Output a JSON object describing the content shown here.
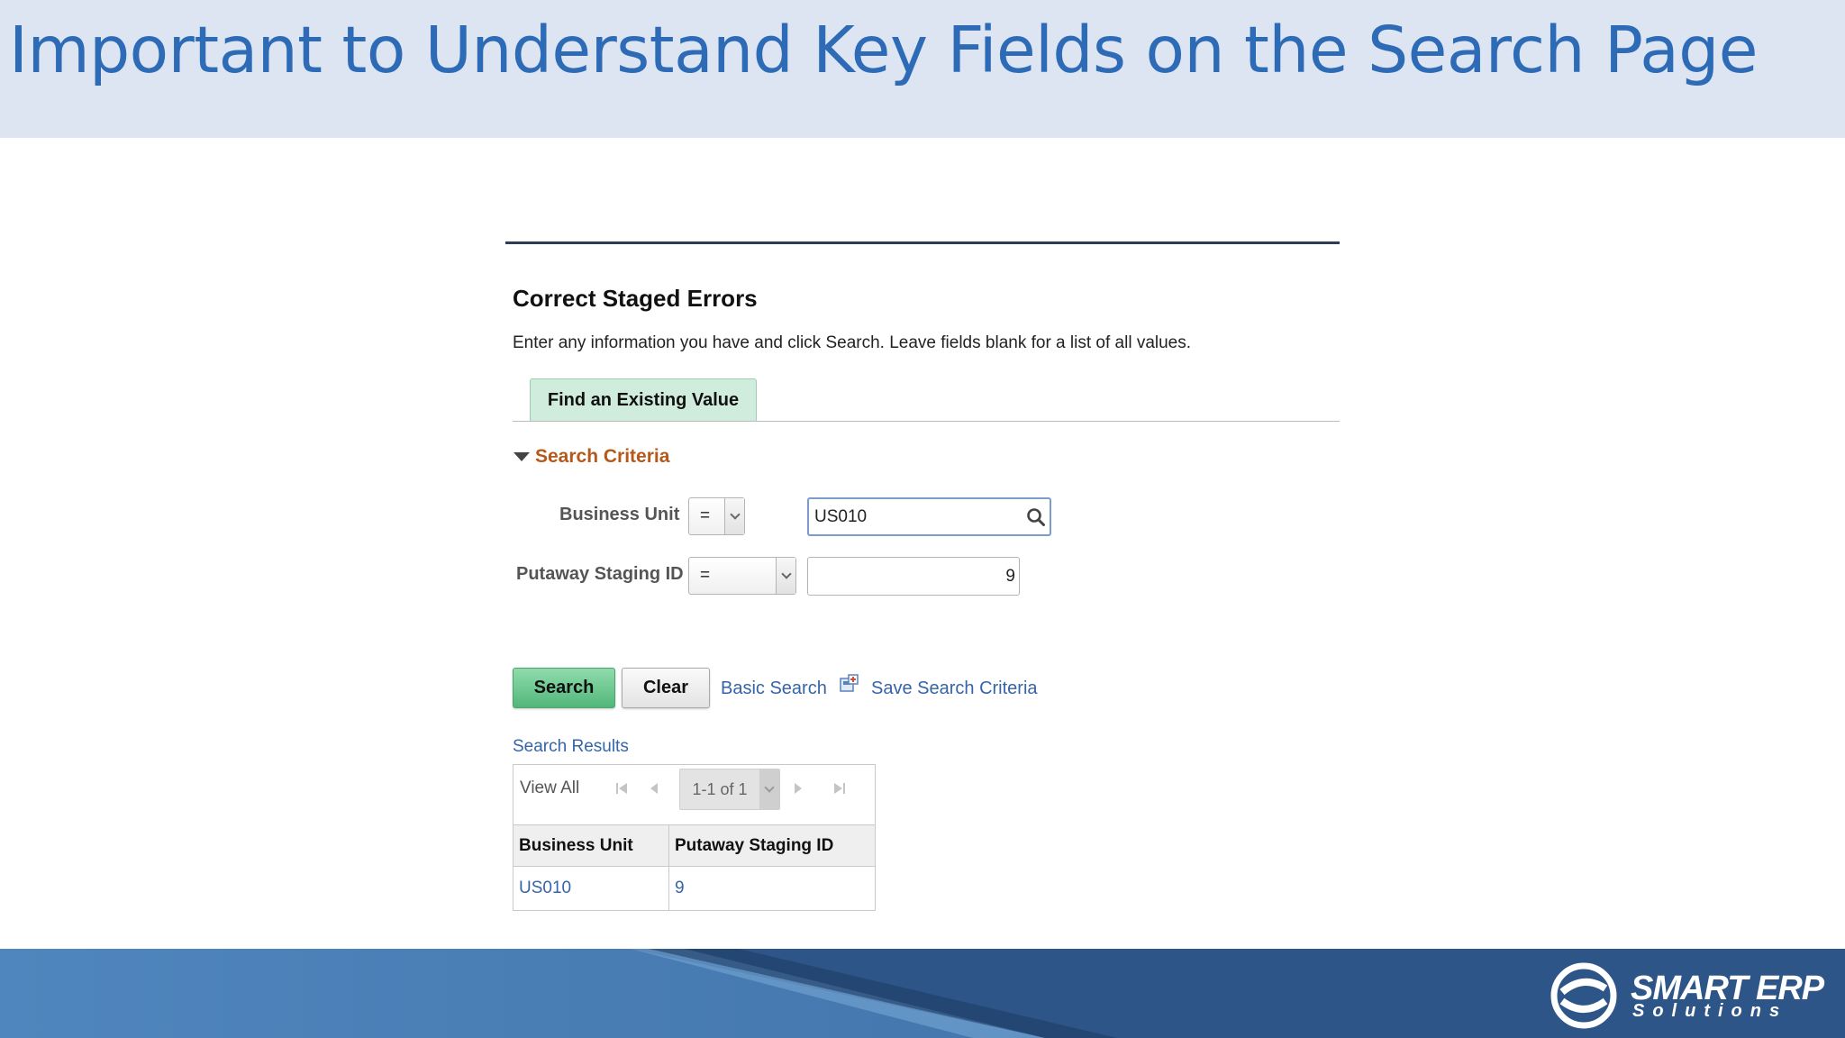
{
  "slide": {
    "title": "Important to Understand Key Fields on the Search Page"
  },
  "page": {
    "title": "Correct Staged Errors",
    "instructions": "Enter any information you have and click Search. Leave fields blank for a list of all values."
  },
  "tabs": [
    {
      "label": "Find an Existing Value",
      "active": true
    }
  ],
  "search_criteria": {
    "label": "Search Criteria",
    "expanded": true,
    "fields": [
      {
        "label": "Business Unit",
        "operator": "=",
        "value": "US010"
      },
      {
        "label": "Putaway Staging ID",
        "operator": "=",
        "value": "9"
      }
    ]
  },
  "actions": {
    "search_label": "Search",
    "clear_label": "Clear",
    "basic_search_label": "Basic Search",
    "save_search_label": "Save Search Criteria"
  },
  "results": {
    "label": "Search Results",
    "view_all": "View All",
    "pager_text": "1-1 of 1",
    "columns": [
      "Business Unit",
      "Putaway Staging ID"
    ],
    "rows": [
      [
        "US010",
        "9"
      ]
    ]
  },
  "branding": {
    "logo_line1": "SMART ERP",
    "logo_line2": "Solutions"
  },
  "colors": {
    "title_blue": "#2e6bb6",
    "banner_bg": "#dde5f2",
    "criteria_orange": "#b5591a",
    "link_blue": "#3564a8",
    "search_green": "#52b77a",
    "tab_green": "#cfecdc",
    "footer_blue": "#4a80b6"
  },
  "icons": {
    "lookup": "search-icon",
    "save": "save-criteria-icon",
    "first": "first-page-icon",
    "prev": "previous-page-icon",
    "next": "next-page-icon",
    "last": "last-page-icon",
    "collapse": "triangle-down-icon"
  }
}
